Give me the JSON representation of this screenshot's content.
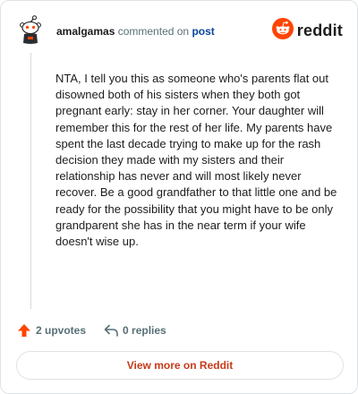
{
  "comment": {
    "username": "amalgamas",
    "action_text": "commented on",
    "post_link": "post",
    "body": "NTA, I tell you this as someone who's parents flat out disowned both of his sisters when they both got pregnant early: stay in her corner. Your daughter will remember this for the rest of her life. My parents have spent the last decade trying to make up for the rash decision they made with my sisters and their relationship has never and will most likely never recover. Be a good grandfather to that little one and be ready for the possibility that you might have to be only grandparent she has in the near term if your wife doesn't wise up.",
    "upvotes": "2 upvotes",
    "replies": "0 replies"
  },
  "brand": {
    "logo_text": "reddit",
    "accent_color": "#ff4500"
  },
  "footer": {
    "view_more_label": "View more on Reddit"
  },
  "icons": {
    "avatar": "snoo-avatar-icon",
    "logo": "reddit-snoo-icon",
    "upvote": "upvote-arrow-icon",
    "reply": "reply-arrow-icon"
  }
}
